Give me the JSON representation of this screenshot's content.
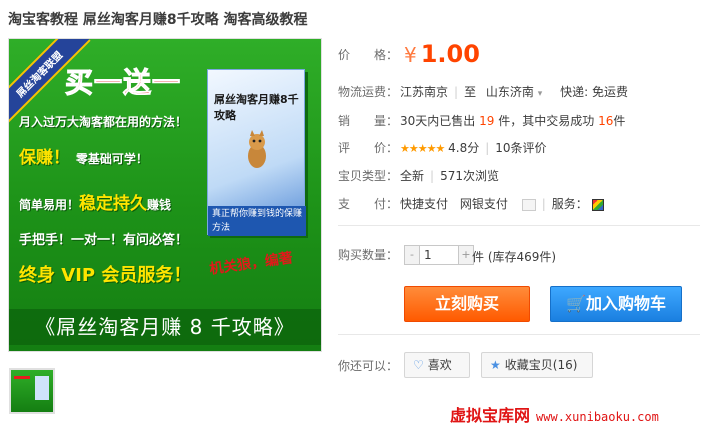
{
  "title": "淘宝客教程 屌丝淘客月赚8千攻略 淘客高级教程",
  "image": {
    "ribbon": "屌丝淘客联盟",
    "headline": "买一送一",
    "line1": "月入过万大淘客都在用的方法！",
    "line2a": "保赚！",
    "line2b": "零基础可学！",
    "line3a": "简单易用！",
    "line3b": "稳定持久",
    "line3c": "赚钱",
    "line4": "手把手！一对一！有问必答！",
    "line5": "终身 VIP 会员服务！",
    "signature": "机关狼，编著",
    "box_title": "屌丝淘客月赚8千攻略",
    "box_band": "真正帮你赚到钱的保赚方法",
    "book_title": "《屌丝淘客月赚 8 千攻略》"
  },
  "price": {
    "label": "价　　格：",
    "currency": "¥",
    "value": "1.00"
  },
  "shipping": {
    "label": "物流运费：",
    "from": "江苏南京",
    "to_word": "至",
    "to": "山东济南",
    "express": "快递: 免运费"
  },
  "sales": {
    "label": "销　　量：",
    "prefix": "30天内已售出",
    "count": "19",
    "mid": "件，其中交易成功",
    "success": "16",
    "suffix": "件"
  },
  "rating": {
    "label": "评　　价：",
    "stars": "★★★★★",
    "score": "4.8分",
    "reviews": "10条评价"
  },
  "condition": {
    "label": "宝贝类型：",
    "type": "全新",
    "views": "571次浏览"
  },
  "payment": {
    "label": "支　　付：",
    "option1": "快捷支付",
    "option2": "网银支付",
    "service_label": "服务："
  },
  "quantity": {
    "label": "购买数量：",
    "value": "1",
    "minus": "-",
    "plus": "+",
    "stock": "件 (库存469件)"
  },
  "buttons": {
    "buy": "立刻购买",
    "cart": "加入购物车"
  },
  "also": {
    "label": "你还可以：",
    "like": "喜欢",
    "favorite": "收藏宝贝(16)"
  },
  "watermark": {
    "cn": "虚拟宝库网",
    "url": "www.xunibaoku.com"
  },
  "colors": {
    "price": "#ff4400",
    "buy": "#ff5a00",
    "cart": "#1a7fe0",
    "promo_green": "#1d9218"
  }
}
